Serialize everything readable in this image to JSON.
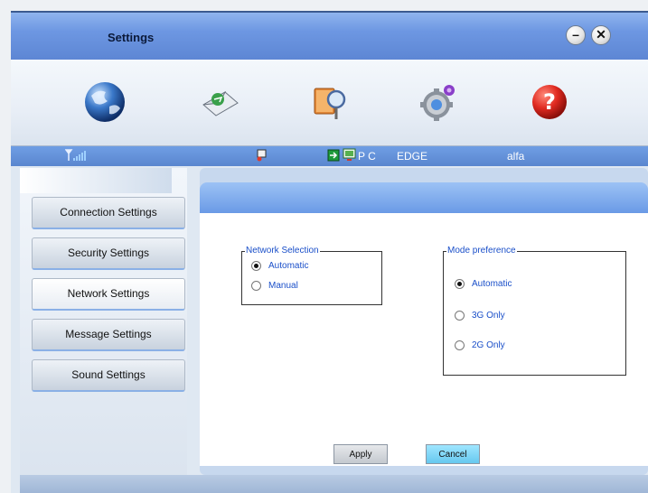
{
  "window": {
    "title": "Settings"
  },
  "titlebar_buttons": {
    "minimize_icon": "minimize-icon",
    "close_icon": "close-icon",
    "minimize_glyph": "–",
    "close_glyph": "✕"
  },
  "toolbar": {
    "items": [
      {
        "icon": "globe-icon"
      },
      {
        "icon": "envelope-icon"
      },
      {
        "icon": "phonebook-icon"
      },
      {
        "icon": "gear-icon"
      },
      {
        "icon": "help-icon"
      }
    ]
  },
  "status": {
    "connection_type": "P C",
    "network_type": "EDGE",
    "operator": "alfa",
    "signal_icon": "signal-icon"
  },
  "sidebar": {
    "items": [
      {
        "label": "Connection Settings"
      },
      {
        "label": "Security Settings"
      },
      {
        "label": "Network Settings"
      },
      {
        "label": "Message Settings"
      },
      {
        "label": "Sound Settings"
      }
    ],
    "active_index": 2
  },
  "network_selection": {
    "legend": "Network Selection",
    "options": [
      {
        "label": "Automatic",
        "selected": true
      },
      {
        "label": "Manual",
        "selected": false
      }
    ]
  },
  "mode_preference": {
    "legend": "Mode preference",
    "options": [
      {
        "label": "Automatic",
        "selected": true
      },
      {
        "label": "3G Only",
        "selected": false
      },
      {
        "label": "2G Only",
        "selected": false
      }
    ]
  },
  "buttons": {
    "apply": "Apply",
    "cancel": "Cancel"
  },
  "colors": {
    "accent": "#5d86d4",
    "label_blue": "#1a4fc9",
    "cancel_button": "#7fd6f5"
  }
}
